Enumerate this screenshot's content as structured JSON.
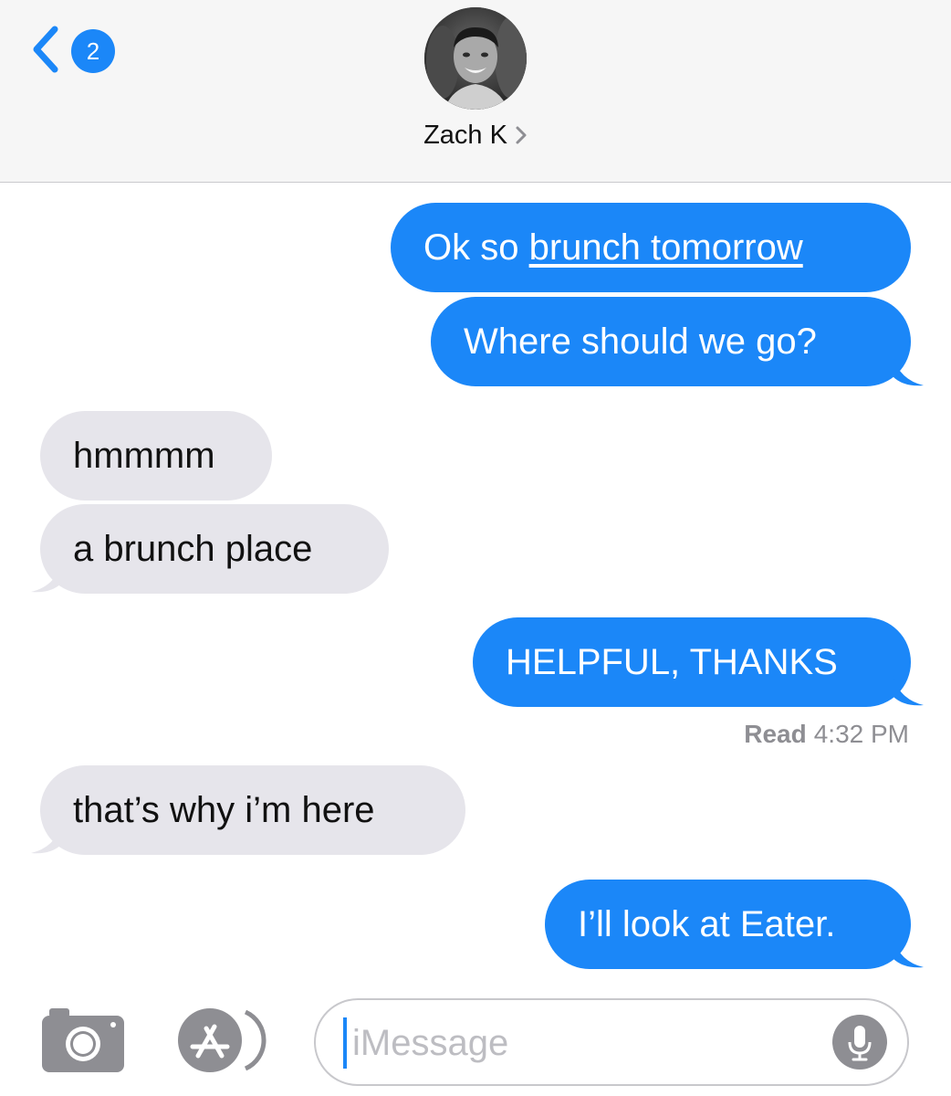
{
  "header": {
    "back_badge": "2",
    "contact_name": "Zach K"
  },
  "messages": [
    {
      "direction": "outgoing",
      "parts": [
        {
          "text": "Ok so ",
          "link": false
        },
        {
          "text": "brunch tomorrow",
          "link": true
        }
      ]
    },
    {
      "direction": "outgoing",
      "text": "Where should we go?"
    },
    {
      "direction": "incoming",
      "text": "hmmmm"
    },
    {
      "direction": "incoming",
      "text": "a brunch place"
    },
    {
      "direction": "outgoing",
      "text": "HELPFUL, THANKS"
    },
    {
      "direction": "incoming",
      "text": "that’s why i’m here"
    },
    {
      "direction": "outgoing",
      "text": "I’ll look at Eater."
    }
  ],
  "read_receipt": {
    "label": "Read",
    "time": "4:32 PM"
  },
  "compose": {
    "placeholder": "iMessage"
  },
  "icons": {
    "back": "chevron-left-icon",
    "contact_detail": "chevron-right-icon",
    "camera": "camera-icon",
    "apps": "app-store-icon",
    "mic": "microphone-icon"
  },
  "colors": {
    "outgoing_bubble": "#1b87f8",
    "incoming_bubble": "#e6e5eb",
    "header_background": "#f6f6f6",
    "badge": "#1b87f8",
    "caret": "#1b87f8"
  }
}
